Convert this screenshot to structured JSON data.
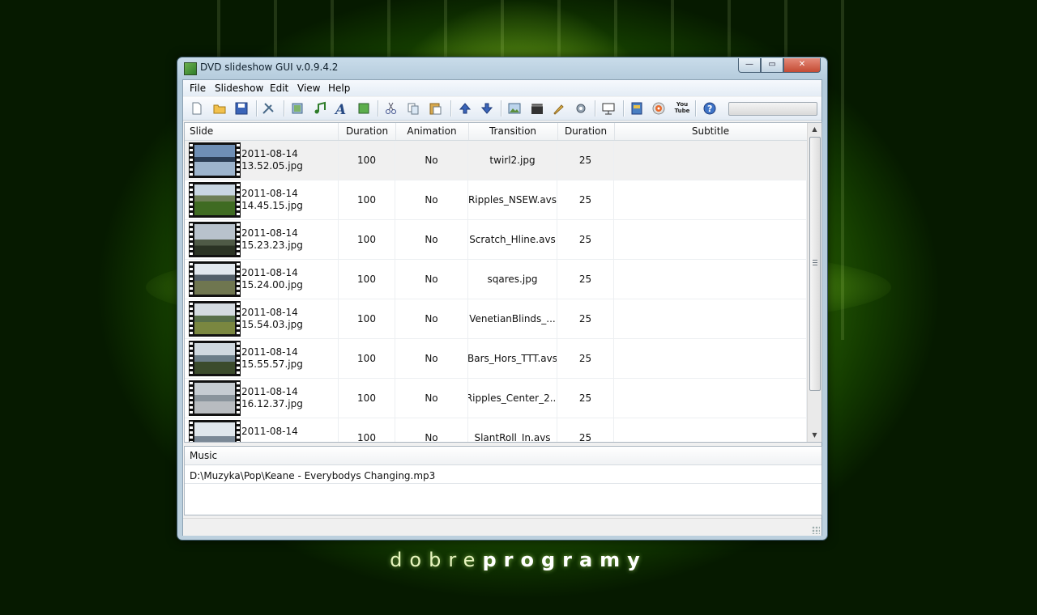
{
  "window": {
    "title": "DVD slideshow GUI v.0.9.4.2"
  },
  "window_buttons": {
    "minimize": "—",
    "maximize": "▭",
    "close": "✕"
  },
  "menu": [
    "File",
    "Slideshow",
    "Edit",
    "View",
    "Help"
  ],
  "toolbar": {
    "icons": [
      "new-file-icon",
      "open-folder-icon",
      "save-icon",
      "tools-icon",
      "add-slide-icon",
      "add-music-icon",
      "add-text-icon",
      "add-background-icon",
      "cut-icon",
      "copy-icon",
      "paste-icon",
      "move-up-icon",
      "move-down-icon",
      "image-edit-icon",
      "video-icon",
      "brush-icon",
      "settings-icon",
      "preview-icon",
      "export-dvd-icon",
      "burn-disc-icon",
      "youtube-icon",
      "help-icon"
    ],
    "youtube_label": "You Tube",
    "progress": 0
  },
  "grid": {
    "columns": [
      "Slide",
      "Duration",
      "Animation",
      "Transition",
      "Duration",
      "Subtitle"
    ],
    "rows": [
      {
        "date": "2011-08-14",
        "time": "13.52.05.jpg",
        "duration": "100",
        "animation": "No",
        "transition": "twirl2.jpg",
        "tduration": "25",
        "subtitle": "",
        "selected": true
      },
      {
        "date": "2011-08-14",
        "time": "14.45.15.jpg",
        "duration": "100",
        "animation": "No",
        "transition": "Ripples_NSEW.avs",
        "tduration": "25",
        "subtitle": ""
      },
      {
        "date": "2011-08-14",
        "time": "15.23.23.jpg",
        "duration": "100",
        "animation": "No",
        "transition": "Scratch_Hline.avs",
        "tduration": "25",
        "subtitle": ""
      },
      {
        "date": "2011-08-14",
        "time": "15.24.00.jpg",
        "duration": "100",
        "animation": "No",
        "transition": "sqares.jpg",
        "tduration": "25",
        "subtitle": ""
      },
      {
        "date": "2011-08-14",
        "time": "15.54.03.jpg",
        "duration": "100",
        "animation": "No",
        "transition": "VenetianBlinds_...",
        "tduration": "25",
        "subtitle": ""
      },
      {
        "date": "2011-08-14",
        "time": "15.55.57.jpg",
        "duration": "100",
        "animation": "No",
        "transition": "Bars_Hors_TTT.avs",
        "tduration": "25",
        "subtitle": ""
      },
      {
        "date": "2011-08-14",
        "time": "16.12.37.jpg",
        "duration": "100",
        "animation": "No",
        "transition": "Ripples_Center_2...",
        "tduration": "25",
        "subtitle": ""
      },
      {
        "date": "2011-08-14",
        "time": "",
        "duration": "100",
        "animation": "No",
        "transition": "SlantRoll_In.avs",
        "tduration": "25",
        "subtitle": ""
      }
    ]
  },
  "music": {
    "header": "Music",
    "tracks": [
      "D:\\Muzyka\\Pop\\Keane  -  Everybodys Changing.mp3"
    ]
  },
  "brand": {
    "part1": "dobre",
    "part2": "programy"
  }
}
